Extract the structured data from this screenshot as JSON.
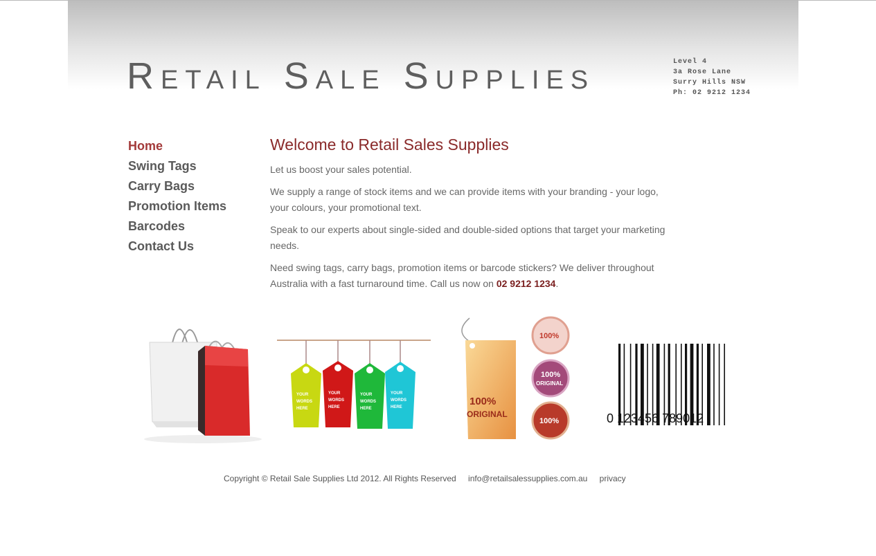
{
  "header": {
    "logo_text": "Retail Sale Supplies",
    "address": [
      "Level 4",
      "3a Rose Lane",
      "Surry Hills NSW",
      "Ph: 02 9212 1234"
    ]
  },
  "nav": {
    "items": [
      {
        "label": "Home",
        "active": true
      },
      {
        "label": "Swing Tags",
        "active": false
      },
      {
        "label": "Carry Bags",
        "active": false
      },
      {
        "label": "Promotion Items",
        "active": false
      },
      {
        "label": "Barcodes",
        "active": false
      },
      {
        "label": "Contact Us",
        "active": false
      }
    ]
  },
  "main": {
    "title": "Welcome to Retail Sales Supplies",
    "p1": "Let us boost your sales potential.",
    "p2": "We supply a range of stock items and we can provide items with your branding - your logo, your colours, your promotional text.",
    "p3": "Speak to our experts about single-sided and double-sided options that target your marketing needs.",
    "p4_before": "Need swing tags, carry bags, promotion items or barcode stickers? We deliver throughout Australia with a fast turnaround time. Call us now on",
    "p4_phone": "02 9212 1234",
    "p4_after": "."
  },
  "products": {
    "tag_text": [
      "YOUR",
      "WORDS",
      "HERE"
    ],
    "seal_text": [
      "100%",
      "ORIGINAL"
    ],
    "barcode_digits": "0 123456 789012"
  },
  "footer": {
    "copyright": "Copyright © Retail Sale Supplies Ltd 2012. All Rights Reserved",
    "email": "info@retailsalessupplies.com.au",
    "privacy": "privacy"
  },
  "colors": {
    "accent": "#8a2a2a",
    "nav_active": "#a33a3a",
    "nav_text": "#5a5a5a",
    "body_text": "#666666"
  }
}
